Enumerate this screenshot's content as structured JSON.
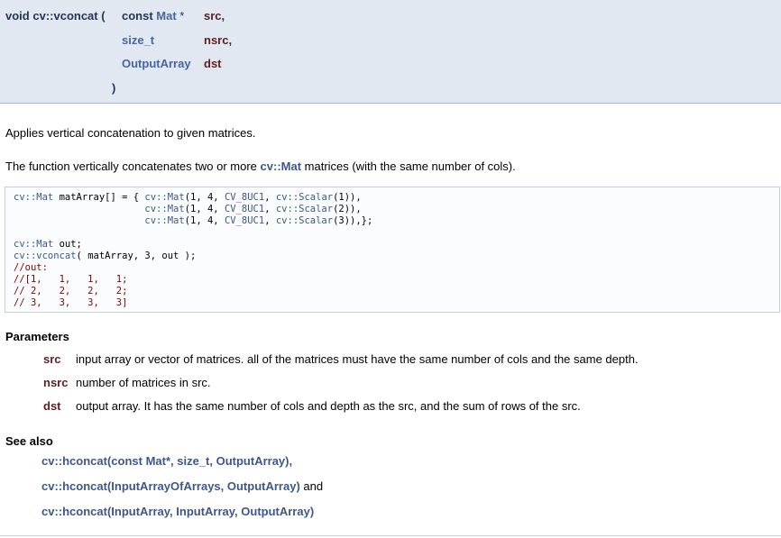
{
  "prototype": {
    "return_type": "void",
    "function_name": "cv::vconcat",
    "open_paren": "(",
    "params": [
      {
        "type_prefix": "const ",
        "type": "Mat",
        "suffix": " *",
        "name": "src",
        "sep": ","
      },
      {
        "type_prefix": "",
        "type": "size_t",
        "suffix": "",
        "name": "nsrc",
        "sep": ","
      },
      {
        "type_prefix": "",
        "type": "OutputArray",
        "suffix": "",
        "name": "dst",
        "sep": ""
      }
    ],
    "close_paren": ")"
  },
  "brief": "Applies vertical concatenation to given matrices.",
  "details": {
    "before": "The function vertically concatenates two or more ",
    "link": "cv::Mat",
    "after": " matrices (with the same number of cols)."
  },
  "code_lines": [
    "cv::Mat matArray[] = { cv::Mat(1, 4, CV_8UC1, cv::Scalar(1)),",
    "                       cv::Mat(1, 4, CV_8UC1, cv::Scalar(2)),",
    "                       cv::Mat(1, 4, CV_8UC1, cv::Scalar(3)),};",
    "",
    "cv::Mat out;",
    "cv::vconcat( matArray, 3, out );",
    "//out:",
    "//[1,   1,   1,   1;",
    "// 2,   2,   2,   2;",
    "// 3,   3,   3,   3]"
  ],
  "parameters": {
    "heading": "Parameters",
    "items": [
      {
        "name": "src",
        "desc": "input array or vector of matrices. all of the matrices must have the same number of cols and the same depth."
      },
      {
        "name": "nsrc",
        "desc": "number of matrices in src."
      },
      {
        "name": "dst",
        "desc": "output array. It has the same number of cols and depth as the src, and the sum of rows of the src."
      }
    ]
  },
  "see_also": {
    "heading": "See also",
    "items": [
      {
        "text": "cv::hconcat(const Mat*, size_t, OutputArray)",
        "suffix": ","
      },
      {
        "text": "cv::hconcat(InputArrayOfArrays, OutputArray)",
        "suffix": " and"
      },
      {
        "text": "cv::hconcat(InputArray, InputArray, OutputArray)",
        "suffix": ""
      }
    ]
  },
  "colors": {
    "prototype_bg": "#e2e8f2",
    "link": "#3d578c",
    "param_name": "#602020",
    "code_bg": "#fbfcfd"
  }
}
